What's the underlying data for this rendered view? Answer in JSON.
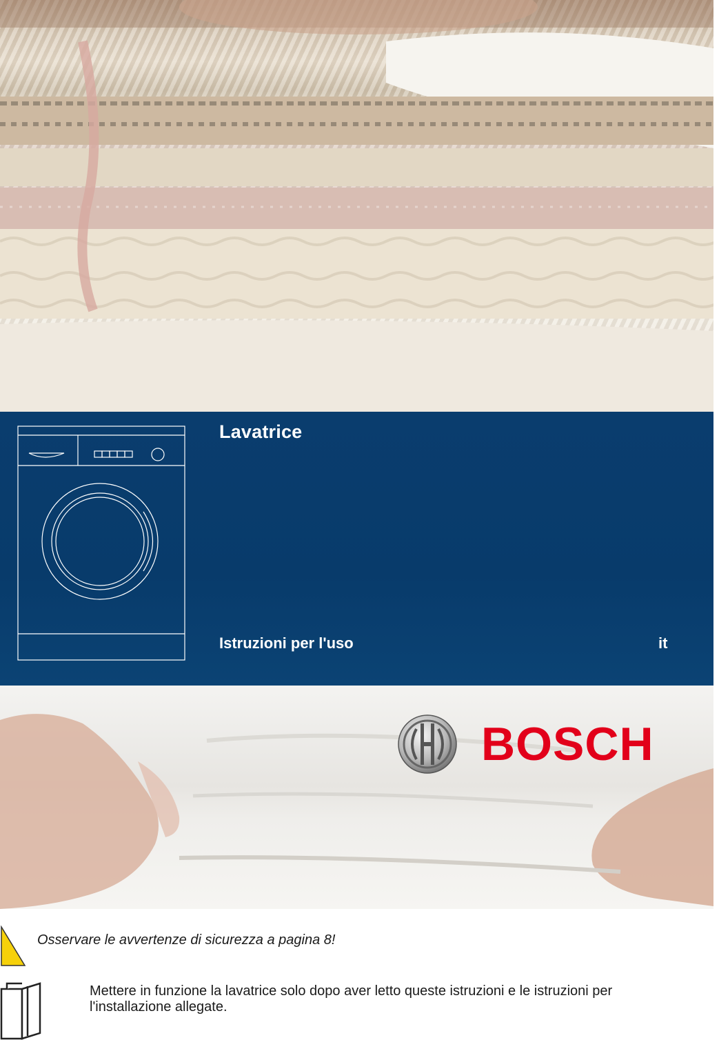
{
  "header": {
    "product_title": "Lavatrice",
    "subtitle": "Istruzioni per l'uso",
    "language_code": "it"
  },
  "brand": {
    "name": "BOSCH",
    "color": "#e2001a",
    "band_color": "#0a3d6e"
  },
  "notices": {
    "safety": "Osservare le avvertenze di sicurezza a pagina 8!",
    "read_first": "Mettere in funzione la lavatrice solo dopo aver letto queste istruzioni e le istruzioni per l'installazione allegate."
  },
  "icons": {
    "washer": "washing-machine-icon",
    "logo": "bosch-armature-logo",
    "warning": "warning-triangle-icon",
    "manual": "open-book-icon"
  }
}
